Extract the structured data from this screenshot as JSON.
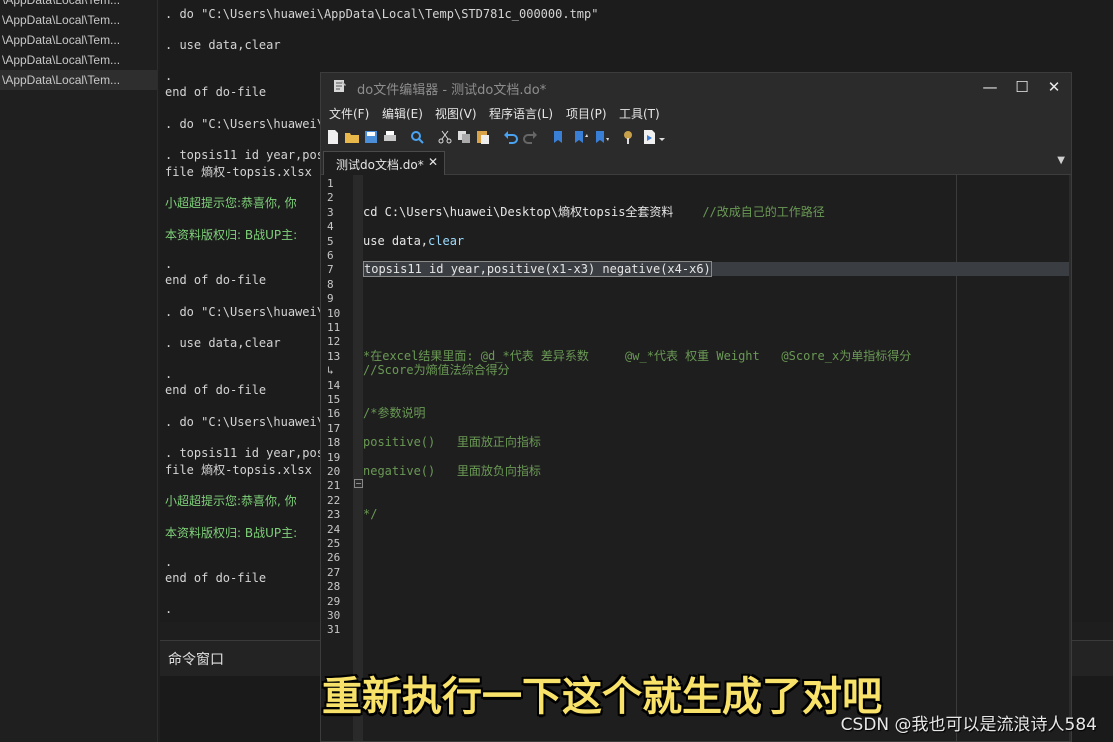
{
  "left_panel": {
    "items": [
      "\\AppData\\Local\\Tem...",
      "\\AppData\\Local\\Tem...",
      "\\AppData\\Local\\Tem...",
      "\\AppData\\Local\\Tem...",
      "\\AppData\\Local\\Tem..."
    ]
  },
  "results": {
    "lines": [
      ". do \"C:\\Users\\huawei\\AppData\\Local\\Temp\\STD781c_000000.tmp\"",
      ". use data,clear",
      ".",
      "end of do-file",
      ". do \"C:\\Users\\huawei\\",
      ". topsis11 id year,pos",
      "file 熵权-topsis.xlsx",
      "小超超提示您:恭喜你, 你",
      "本资料版权归: B战UP主:",
      ".",
      "end of do-file",
      ". do \"C:\\Users\\huawei\\",
      ". use data,clear",
      ".",
      "end of do-file",
      ". do \"C:\\Users\\huawei\\",
      ". topsis11 id year,pos",
      "file 熵权-topsis.xlsx",
      "小超超提示您:恭喜你, 你",
      "本资料版权归: B战UP主:",
      ".",
      "end of do-file",
      "."
    ]
  },
  "command_window": {
    "label": "命令窗口"
  },
  "editor": {
    "title": "do文件编辑器 - 测试do文档.do*",
    "window_buttons": {
      "minimize": "—",
      "maximize": "☐",
      "close": "✕"
    },
    "menu": [
      "文件(F)",
      "编辑(E)",
      "视图(V)",
      "程序语言(L)",
      "项目(P)",
      "工具(T)"
    ],
    "tab": {
      "label": "测试do文档.do*",
      "close": "✕"
    },
    "line_numbers": [
      "1",
      "2",
      "3",
      "4",
      "5",
      "6",
      "7",
      "8",
      "9",
      "10",
      "11",
      "12",
      "13",
      "",
      "14",
      "15",
      "16",
      "17",
      "18",
      "19",
      "20",
      "21",
      "22",
      "23",
      "24",
      "25",
      "26",
      "27",
      "28",
      "29",
      "30",
      "31"
    ],
    "code": {
      "l3_cmd": "cd C:\\Users\\huawei\\Desktop\\熵权topsis全套资料",
      "l3_comment": "//改成自己的工作路径",
      "l5_cmd": "use data,",
      "l5_kw": "clear",
      "l7": "topsis11 id year,positive(x1-x3) negative(x4-x6)",
      "l13a": "*在excel结果里面: @d_*代表 差异系数     @w_*代表 权重 Weight   @Score_x为单指标得分",
      "l13b": "//Score为熵值法综合得分",
      "l16": "/*参数说明",
      "l18": "positive()   里面放正向指标",
      "l20": "negative()   里面放负向指标",
      "l23": "*/"
    }
  },
  "subtitle": "重新执行一下这个就生成了对吧",
  "watermark": "CSDN @我也可以是流浪诗人584"
}
